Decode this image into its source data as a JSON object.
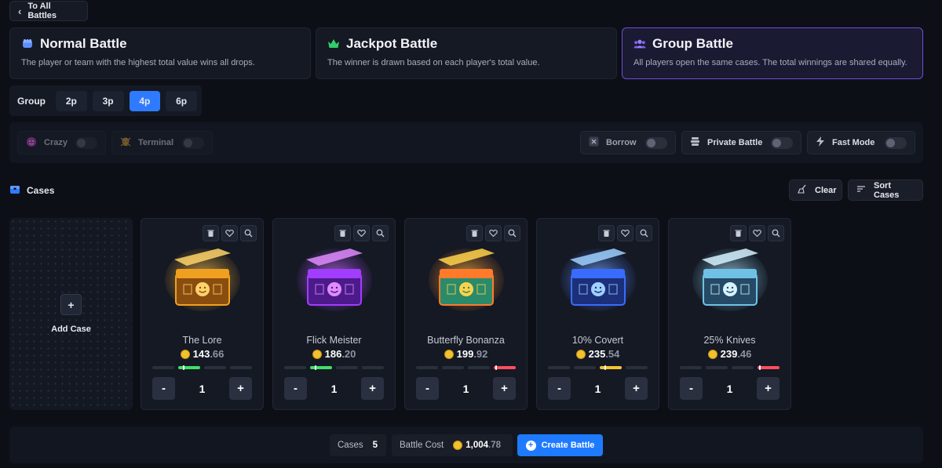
{
  "nav": {
    "back_label": "To All Battles"
  },
  "modes": [
    {
      "title": "Normal Battle",
      "description": "The player or team with the highest total value wins all drops.",
      "icon": "fist-icon",
      "active": false
    },
    {
      "title": "Jackpot Battle",
      "description": "The winner is drawn based on each player's total value.",
      "icon": "crown-icon",
      "active": false
    },
    {
      "title": "Group Battle",
      "description": "All players open the same cases. The total winnings are shared equally.",
      "icon": "group-icon",
      "active": true
    }
  ],
  "group": {
    "label": "Group",
    "options": [
      "2p",
      "3p",
      "4p",
      "6p"
    ],
    "selected": "4p"
  },
  "options": {
    "crazy": "Crazy",
    "terminal": "Terminal",
    "borrow": "Borrow",
    "private_battle": "Private Battle",
    "fast_mode": "Fast Mode"
  },
  "cases_section": {
    "title": "Cases",
    "clear_label": "Clear",
    "sort_label": "Sort Cases",
    "add_label": "Add Case"
  },
  "cases": [
    {
      "name": "The Lore",
      "price_int": "143",
      "price_dec": ".66",
      "qty": "1",
      "rarity_color": "#3ee06a",
      "rarity_segment": 1
    },
    {
      "name": "Flick Meister",
      "price_int": "186",
      "price_dec": ".20",
      "qty": "1",
      "rarity_color": "#3ee06a",
      "rarity_segment": 1
    },
    {
      "name": "Butterfly Bonanza",
      "price_int": "199",
      "price_dec": ".92",
      "qty": "1",
      "rarity_color": "#ff4d5e",
      "rarity_segment": 3
    },
    {
      "name": "10% Covert",
      "price_int": "235",
      "price_dec": ".54",
      "qty": "1",
      "rarity_color": "#f4c430",
      "rarity_segment": 2
    },
    {
      "name": "25% Knives",
      "price_int": "239",
      "price_dec": ".46",
      "qty": "1",
      "rarity_color": "#ff4d5e",
      "rarity_segment": 3
    }
  ],
  "footer": {
    "cases_label": "Cases",
    "cases_count": "5",
    "cost_label": "Battle Cost",
    "cost_int": "1,004",
    "cost_dec": ".78",
    "create_label": "Create Battle"
  },
  "colors": {
    "accent": "#1e7bff",
    "active_border": "#6d4fd8",
    "coin": "#f2c12e"
  }
}
